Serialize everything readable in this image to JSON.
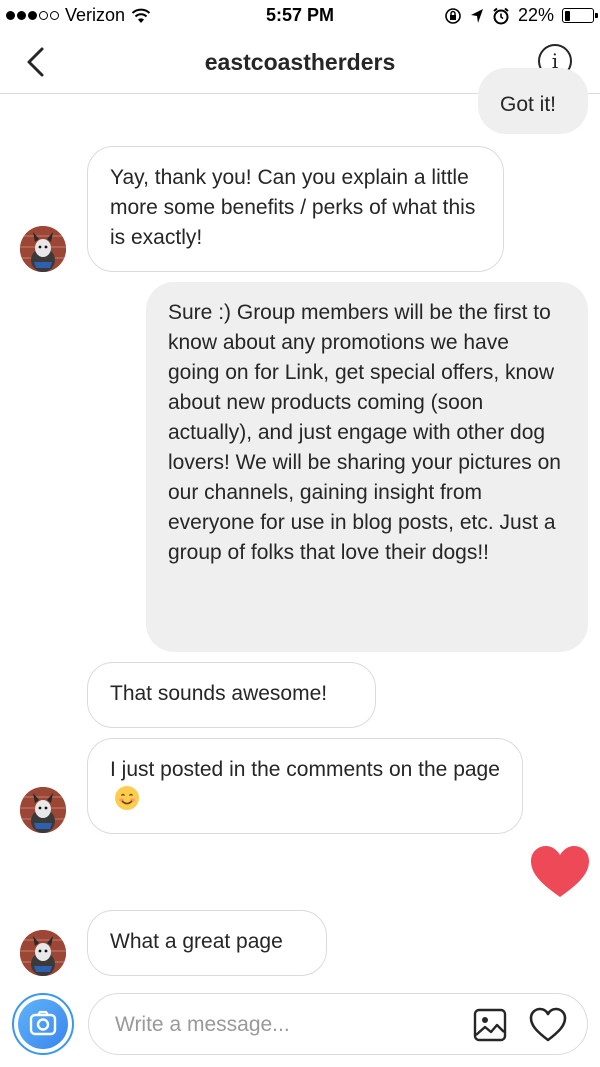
{
  "status_bar": {
    "carrier": "Verizon",
    "time": "5:57 PM",
    "battery": "22%",
    "battery_level": 0.22
  },
  "header": {
    "title": "eastcoastherders",
    "info_glyph": "i",
    "back_icon": "chevron-left-icon",
    "info_icon": "info-icon"
  },
  "messages": [
    {
      "direction": "outgoing",
      "text": "Got it!"
    },
    {
      "direction": "incoming",
      "text": "Yay, thank you! Can you explain a little more some benefits / perks of what this is exactly!"
    },
    {
      "direction": "outgoing",
      "text": "Sure :) Group members will be the first to know about any promotions we have going on for Link, get special offers, know about new products coming (soon actually), and just engage with other dog lovers! We will be sharing your pictures on our channels, gaining insight from everyone for use in blog posts, etc. Just a group of folks that love their dogs!!"
    },
    {
      "direction": "incoming",
      "text": "That sounds awesome!"
    },
    {
      "direction": "incoming",
      "text": "I just posted in the comments on the page",
      "emoji": "smiling-face-emoji"
    },
    {
      "direction": "outgoing",
      "type": "heart",
      "icon": "heart-icon"
    },
    {
      "direction": "incoming",
      "text": "What a great page"
    }
  ],
  "composer": {
    "placeholder": "Write a message...",
    "camera_icon": "camera-icon",
    "gallery_icon": "image-icon",
    "like_icon": "heart-outline-icon"
  },
  "colors": {
    "accent": "#3897f0",
    "heart": "#ed4956",
    "outgoing_bubble": "#efefef",
    "border": "#dbdbdb"
  }
}
